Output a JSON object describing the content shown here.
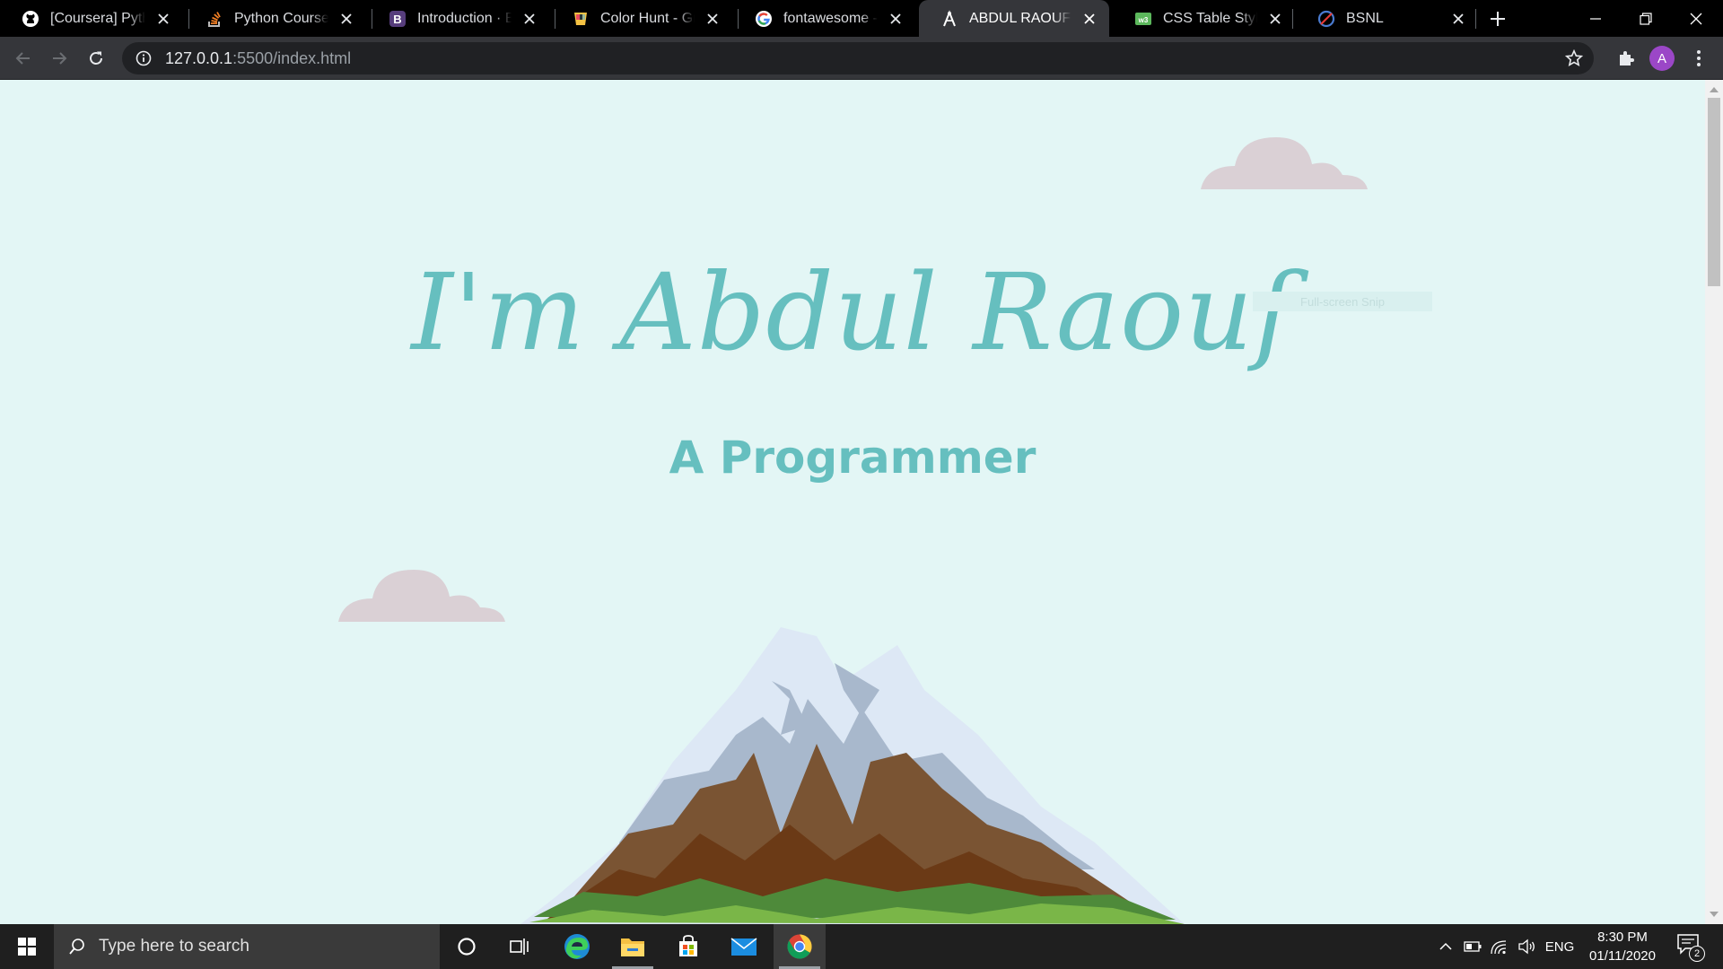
{
  "browser": {
    "tabs": [
      {
        "title": "[Coursera] Python",
        "icon": "github-icon"
      },
      {
        "title": "Python Coursera Assignment",
        "icon": "stackoverflow-icon"
      },
      {
        "title": "Introduction · Bootstrap",
        "icon": "bootstrap-icon"
      },
      {
        "title": "Color Hunt - Grey",
        "icon": "color-hunt-icon"
      },
      {
        "title": "fontawesome - Google",
        "icon": "google-icon"
      },
      {
        "title": "ABDUL RAOUF",
        "icon": "compass-icon",
        "active": true
      },
      {
        "title": "CSS Table Style",
        "icon": "css-table-icon"
      },
      {
        "title": "BSNL",
        "icon": "bsnl-icon"
      }
    ],
    "url_host": "127.0.0.1",
    "url_rest": ":5500/index.html"
  },
  "page": {
    "title": "I'm Abdul Raouf",
    "subtitle": "A Programmer",
    "snip_overlay": "Full-screen Snip",
    "background": "#e3f6f5",
    "accent": "#66bfbf",
    "cloud_color": "#dad0d5"
  },
  "taskbar": {
    "search_placeholder": "Type here to search",
    "language": "ENG",
    "time": "8:30 PM",
    "date": "01/11/2020",
    "notification_count": "2",
    "apps": [
      "cortana-icon",
      "task-view-icon",
      "edge-icon",
      "file-explorer-icon",
      "store-icon",
      "mail-icon",
      "chrome-icon"
    ]
  }
}
